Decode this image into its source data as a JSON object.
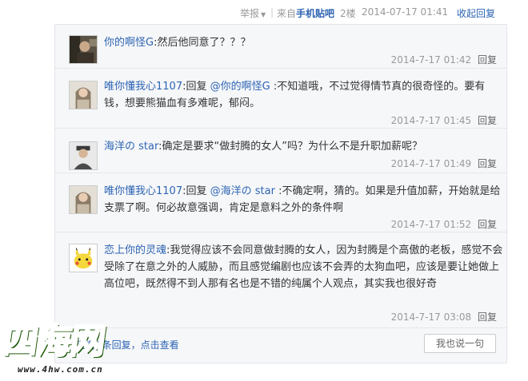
{
  "header": {
    "report_label": "举报",
    "source_prefix": "来自",
    "source_name": "手机贴吧",
    "floor": "2楼",
    "datetime": "2014-07-17 01:41",
    "collapse_label": "收起回复"
  },
  "replies": [
    {
      "user": "你的啊怪G",
      "parts": [
        "然后他同意了？？？"
      ],
      "mention": "",
      "tail": "",
      "time": "2014-7-17 01:42",
      "reply_label": "回复",
      "avatar": "avatar-dark-photo"
    },
    {
      "user": "唯你懂我心1107",
      "parts": [
        "回复 "
      ],
      "mention": "@你的啊怪G",
      "tail": " :不知道哦，不过觉得情节真的很奇怪的。要有钱，想要熊猫血有多难呢，郁闷。",
      "time": "2014-7-17 01:45",
      "reply_label": "回复",
      "avatar": "avatar-girl-photo"
    },
    {
      "user": "海洋の star",
      "parts": [
        "确定是要求“做封腾的女人”吗？为什么不是升职加薪呢？"
      ],
      "mention": "",
      "tail": "",
      "time": "2014-7-17 01:49",
      "reply_label": "回复",
      "avatar": "avatar-man-photo"
    },
    {
      "user": "唯你懂我心1107",
      "parts": [
        "回复 "
      ],
      "mention": "@海洋の star",
      "tail": " :不确定啊，猜的。如果是升值加薪，开始就是给支票了啊。何必故意强调，肯定是意料之外的条件啊",
      "time": "2014-7-17 01:52",
      "reply_label": "回复",
      "avatar": "avatar-girl-photo"
    },
    {
      "user": "恋上你的灵魂",
      "parts": [
        "我觉得应该不会同意做封腾的女人，因为封腾是个高傲的老板，感觉不会受除了在意之外的人威胁，而且感觉编剧也应该不会弄的太狗血吧，应该是要让她做上高位吧，既然得不到人那有名也是不错的纯属个人观点，其实我也很好奇"
      ],
      "mention": "",
      "tail": "",
      "time": "2014-7-17 03:08",
      "reply_label": "回复",
      "avatar": "avatar-pikachu"
    }
  ],
  "footer": {
    "view_more": "还有1条回复，点击查看",
    "say_button": "我也说一句"
  },
  "watermark": {
    "logo": "四海网",
    "url": "www.4hw.com.cn"
  }
}
